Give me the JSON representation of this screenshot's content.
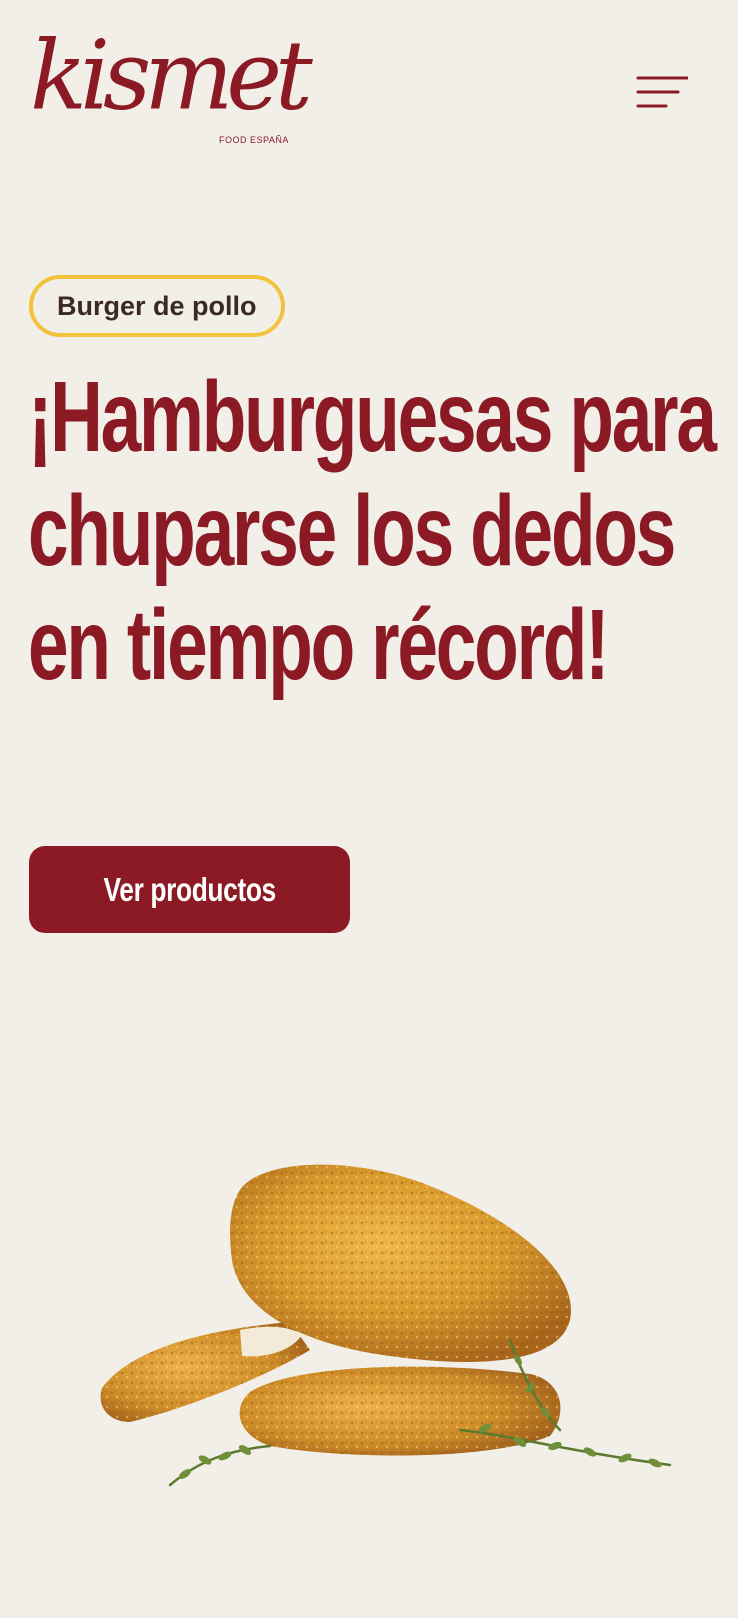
{
  "header": {
    "brand_name": "kismet",
    "brand_subtitle": "FOOD ESPAÑA",
    "menu_icon": "hamburger-menu-icon"
  },
  "hero": {
    "badge_label": "Burger de pollo",
    "headline": "¡Hamburguesas para chuparse los dedos en tiempo récord!",
    "cta_label": "Ver productos",
    "image_icon": "chicken-burger-patties-image"
  },
  "colors": {
    "background": "#f2eee8",
    "brand_red": "#8b1a25",
    "badge_border": "#f2c23c",
    "badge_text": "#3a2a1f"
  }
}
